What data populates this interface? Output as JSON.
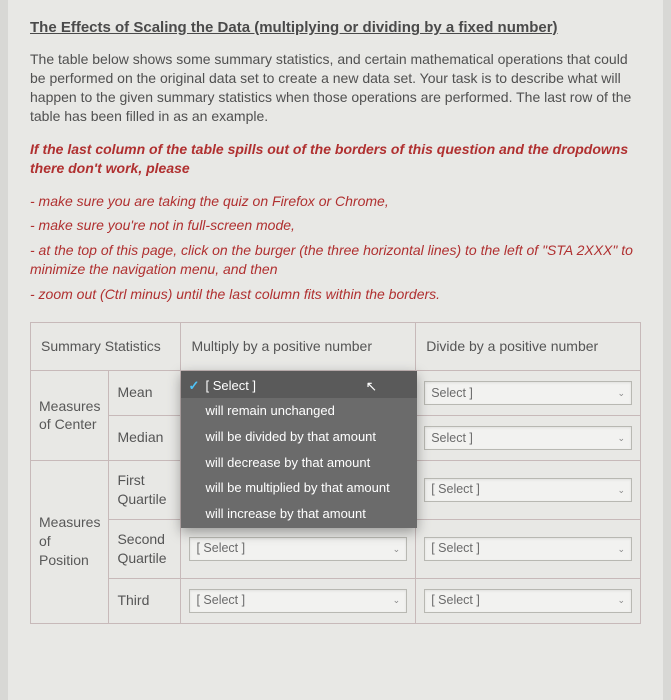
{
  "title": "The Effects of Scaling the Data (multiplying or dividing by a fixed number)",
  "intro": "The table below shows some summary statistics, and certain mathematical operations that could be performed on the original data set to create a new data set.  Your task is to describe what will happen to the given summary statistics when those operations are performed.  The last row of the table has been filled in as an example.",
  "warn_lead": "If the last column of the table spills out of the borders of this question and the dropdowns there don't work, please",
  "warn_items": [
    "- make sure you are taking the quiz on Firefox or Chrome,",
    "- make sure you're not in full-screen mode,",
    "- at the top of this page, click on the burger (the three horizontal lines) to the left of \"STA 2XXX\" to minimize the navigation menu, and then",
    "- zoom out (Ctrl minus) until the last column fits within the borders."
  ],
  "headers": {
    "c1": "Summary Statistics",
    "c2": "Multiply by a positive number",
    "c3": "Divide by a positive number"
  },
  "groups": {
    "center": "Measures of Center",
    "position": "Measures of Position"
  },
  "rows": {
    "mean": "Mean",
    "median": "Median",
    "q1": "First Quartile",
    "q2": "Second Quartile",
    "q3": "Third"
  },
  "select_placeholder": "[ Select ]",
  "select_placeholder_tight": "Select ]",
  "dropdown_options": [
    "[ Select ]",
    "will remain unchanged",
    "will be divided by that amount",
    "will decrease by that amount",
    "will be multiplied by that amount",
    "will increase by that amount"
  ]
}
